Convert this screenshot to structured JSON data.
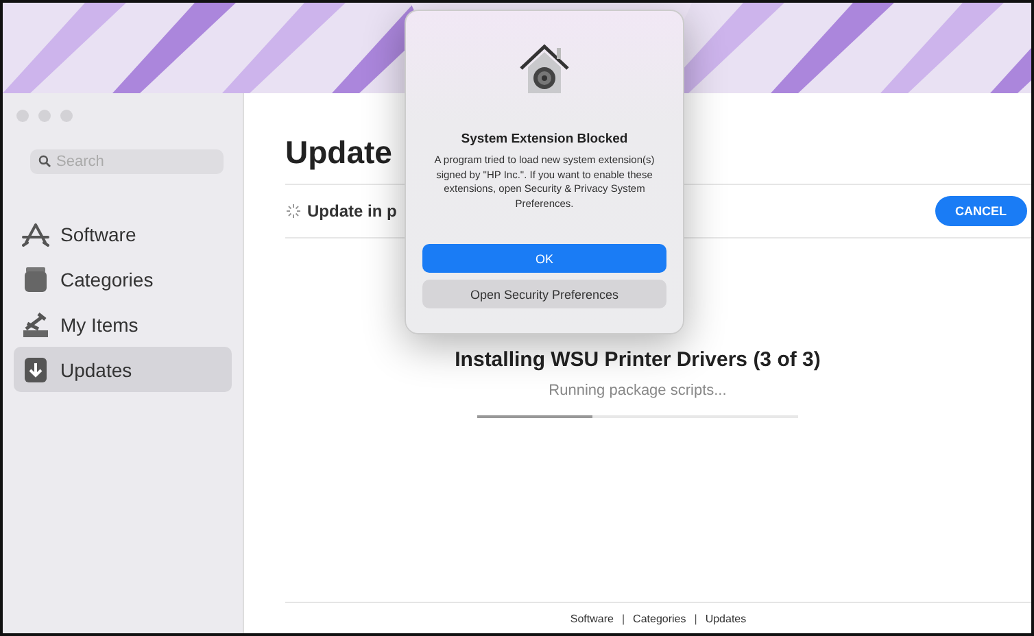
{
  "sidebar": {
    "search": {
      "placeholder": "Search"
    },
    "items": [
      {
        "label": "Software",
        "selected": false
      },
      {
        "label": "Categories",
        "selected": false
      },
      {
        "label": "My Items",
        "selected": false
      },
      {
        "label": "Updates",
        "selected": true
      }
    ]
  },
  "main": {
    "title": "Update",
    "status": "Update in p",
    "cancel": "CANCEL",
    "install": {
      "title": "Installing WSU Printer Drivers (3 of 3)",
      "subtitle": "Running package scripts...",
      "level": 0.36
    },
    "footer": [
      {
        "kind": "link",
        "text": "Software"
      },
      {
        "kind": "sep",
        "text": "|"
      },
      {
        "kind": "link",
        "text": "Categories"
      },
      {
        "kind": "sep",
        "text": "|"
      },
      {
        "kind": "link",
        "text": "Updates"
      }
    ]
  },
  "dialog": {
    "title": "System Extension Blocked",
    "message": "A program tried to load new system extension(s) signed by \"HP Inc.\". If you want to enable these extensions, open Security & Privacy System Preferences.",
    "buttons": [
      {
        "label": "OK",
        "kind": "primary"
      },
      {
        "label": "Open Security Preferences",
        "kind": "secondary"
      }
    ]
  }
}
